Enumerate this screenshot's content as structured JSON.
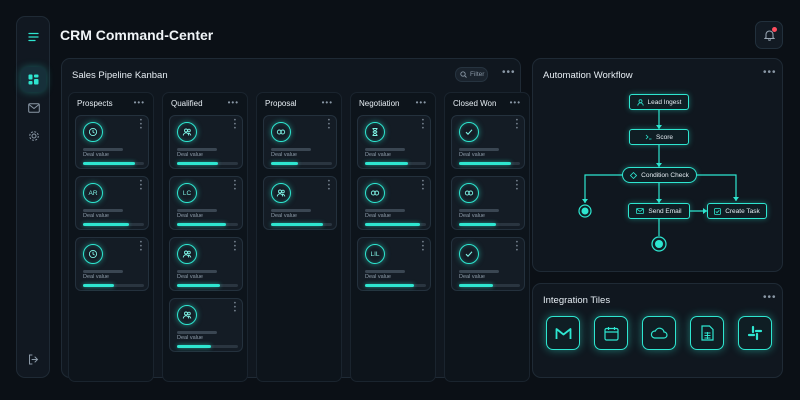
{
  "app": {
    "title": "CRM Command-Center"
  },
  "rail": {
    "items": [
      {
        "icon": "menu-icon"
      },
      {
        "icon": "dashboard-icon"
      },
      {
        "icon": "mail-icon"
      },
      {
        "icon": "settings-icon"
      },
      {
        "icon": "logout-icon"
      }
    ]
  },
  "notifications": {
    "icon": "bell-icon",
    "has_unread": true
  },
  "pipeline": {
    "title": "Sales Pipeline Kanban",
    "filter_label": "Filter",
    "columns": [
      {
        "title": "Prospects",
        "cards": [
          {
            "avatar": "",
            "icon": "clock-icon",
            "deal_label": "Deal value",
            "progress": 0.85
          },
          {
            "avatar": "AR",
            "deal_label": "Deal value",
            "progress": 0.75
          },
          {
            "avatar": "",
            "icon": "clock-icon",
            "deal_label": "Deal value",
            "progress": 0.5
          }
        ]
      },
      {
        "title": "Qualified",
        "cards": [
          {
            "avatar": "",
            "icon": "users-icon",
            "deal_label": "Deal value",
            "progress": 0.68
          },
          {
            "avatar": "LC",
            "deal_label": "Deal value",
            "progress": 0.8
          },
          {
            "avatar": "",
            "icon": "users-icon",
            "deal_label": "Deal value",
            "progress": 0.7
          },
          {
            "avatar": "",
            "icon": "users-icon",
            "deal_label": "Deal value",
            "progress": 0.55
          }
        ]
      },
      {
        "title": "Proposal",
        "cards": [
          {
            "avatar": "",
            "icon": "link-icon",
            "deal_label": "Deal value",
            "progress": 0.45
          },
          {
            "avatar": "",
            "icon": "users-icon",
            "deal_label": "Deal value",
            "progress": 0.85
          }
        ]
      },
      {
        "title": "Negotiation",
        "cards": [
          {
            "avatar": "",
            "icon": "hourglass-icon",
            "deal_label": "Deal value",
            "progress": 0.7
          },
          {
            "avatar": "",
            "icon": "link-icon",
            "deal_label": "Deal value",
            "progress": 0.9
          },
          {
            "avatar": "LIL",
            "deal_label": "Deal value",
            "progress": 0.8
          }
        ]
      },
      {
        "title": "Closed Won",
        "cards": [
          {
            "avatar": "",
            "icon": "check-icon",
            "deal_label": "Deal value",
            "progress": 0.85
          },
          {
            "avatar": "",
            "icon": "link-icon",
            "deal_label": "Deal value",
            "progress": 0.6
          },
          {
            "avatar": "",
            "icon": "check-icon",
            "deal_label": "Deal value",
            "progress": 0.55
          }
        ]
      }
    ]
  },
  "workflow": {
    "title": "Automation Workflow",
    "nodes": {
      "lead": {
        "label": "Lead Ingest",
        "icon": "user-icon"
      },
      "score": {
        "label": "Score",
        "icon": "code-icon"
      },
      "condition": {
        "label": "Condition Check",
        "icon": "diamond-icon"
      },
      "email": {
        "label": "Send Email",
        "icon": "mail-icon"
      },
      "task": {
        "label": "Create Task",
        "icon": "checkbox-icon"
      }
    }
  },
  "integrations": {
    "title": "Integration Tiles",
    "tiles": [
      {
        "icon": "gmail-icon"
      },
      {
        "icon": "calendar-icon"
      },
      {
        "icon": "cloud-icon"
      },
      {
        "icon": "sheets-icon"
      },
      {
        "icon": "slack-icon"
      }
    ]
  },
  "colors": {
    "accent": "#2ee6d0",
    "background": "#0b1016",
    "panel": "#10171f",
    "alert": "#ff4d5e"
  }
}
